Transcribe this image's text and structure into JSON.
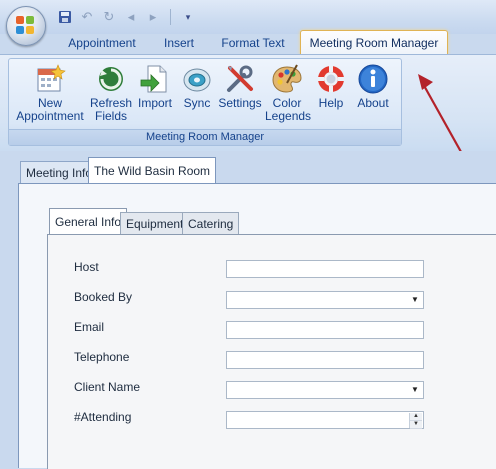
{
  "window": {
    "title_ghost": ""
  },
  "quick_access": [
    {
      "name": "save-icon",
      "glyph": "💾"
    },
    {
      "name": "undo-icon",
      "glyph": "↶"
    },
    {
      "name": "redo-icon",
      "glyph": "↷"
    },
    {
      "name": "back-icon",
      "glyph": "◂"
    },
    {
      "name": "forward-icon",
      "glyph": "▸"
    }
  ],
  "ribbon": {
    "tabs": [
      "Appointment",
      "Insert",
      "Format Text",
      "Meeting Room Manager"
    ],
    "active_tab": "Meeting Room Manager",
    "group_label": "Meeting Room Manager",
    "buttons": [
      {
        "label1": "New",
        "label2": "Appointment",
        "icon": "new-appointment-icon"
      },
      {
        "label1": "Refresh",
        "label2": "Fields",
        "icon": "refresh-icon"
      },
      {
        "label1": "Import",
        "label2": "",
        "icon": "import-icon"
      },
      {
        "label1": "Sync",
        "label2": "",
        "icon": "sync-icon"
      },
      {
        "label1": "Settings",
        "label2": "",
        "icon": "settings-icon"
      },
      {
        "label1": "Color",
        "label2": "Legends",
        "icon": "palette-icon"
      },
      {
        "label1": "Help",
        "label2": "",
        "icon": "help-icon"
      },
      {
        "label1": "About",
        "label2": "",
        "icon": "info-icon"
      }
    ]
  },
  "outer_tabs": [
    "Meeting Info",
    "The Wild Basin Room"
  ],
  "inner_tabs": [
    "General Info",
    "Equipment",
    "Catering"
  ],
  "form": {
    "host_label": "Host",
    "host_value": "",
    "booked_by_label": "Booked By",
    "booked_by_value": "",
    "email_label": "Email",
    "email_value": "",
    "telephone_label": "Telephone",
    "telephone_value": "",
    "client_name_label": "Client Name",
    "client_name_value": "",
    "attending_label": "#Attending",
    "attending_value": ""
  },
  "colors": {
    "accent": "#15428b",
    "annotation_arrow": "#b3222a",
    "active_tab_border": "#e0b354"
  }
}
